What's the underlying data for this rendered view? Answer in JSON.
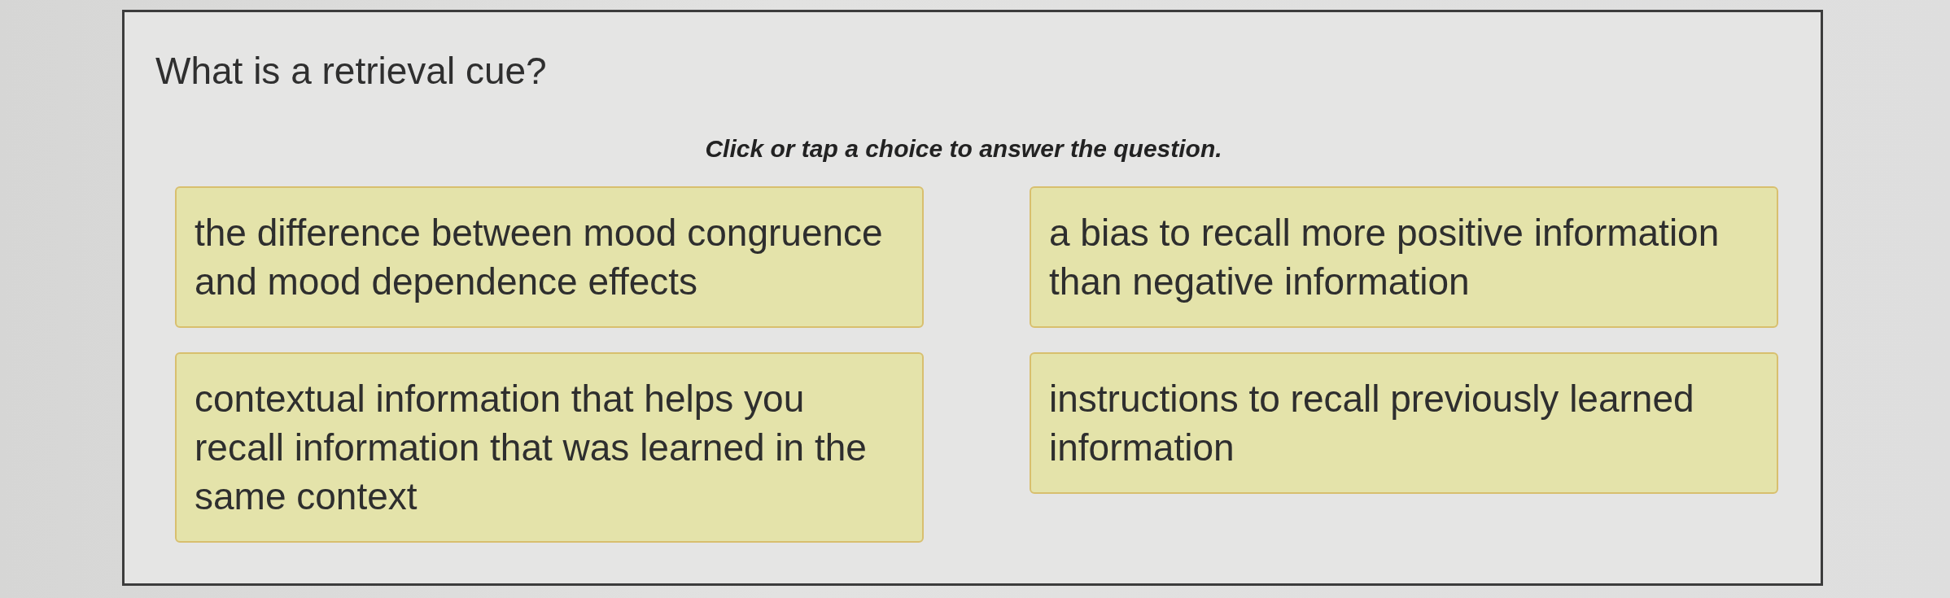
{
  "question": "What is a retrieval cue?",
  "instruction": "Click or tap a choice to answer the question.",
  "choices": [
    {
      "text": "the difference between mood congruence and mood dependence effects",
      "selected": false
    },
    {
      "text": "a bias to recall more positive information than negative information",
      "selected": false
    },
    {
      "text": "contextual information that helps you recall information that was learned in the same context",
      "selected": false
    },
    {
      "text": "instructions to recall previously learned information",
      "selected": false
    }
  ]
}
